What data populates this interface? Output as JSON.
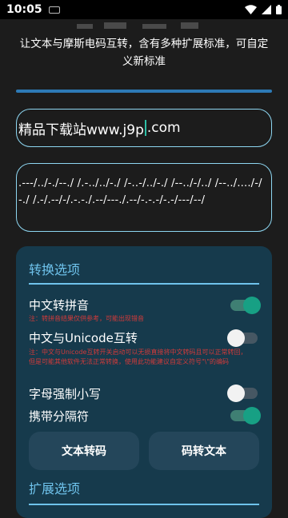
{
  "status_bar": {
    "time": "10:05"
  },
  "header": {
    "subtitle": "让文本与摩斯电码互转，含有多种扩展标准，可自定义新标准"
  },
  "input": {
    "text_before_caret": "精品下载站www.j9p",
    "text_after_caret": ".com"
  },
  "output": {
    "morse": ".---/../-./--./ /.-../../-./ /-..-/../-./ /--../-/../ /--../..../-/-./ /.-/.--/-/.-.-./.--/---./.--/-.-.-/-.-/---/--/"
  },
  "options_card": {
    "section_title": "转换选项",
    "options": [
      {
        "label": "中文转拼音",
        "note": "注：转拼音结果仅供参考，可能出现错音",
        "state": "on"
      },
      {
        "label": "中文与Unicode互转",
        "note": "注：中文与Unicode互转开关启动可以无损直接将中文转码且可以正常转回，但是可能其他软件无法正常转换，使用此功能建议自定义符号\"\\\"的编码",
        "state": "off"
      },
      {
        "label": "字母强制小写",
        "state": "off"
      },
      {
        "label": "携带分隔符",
        "state": "on"
      }
    ],
    "buttons": {
      "encode": "文本转码",
      "decode": "码转文本"
    },
    "extend_title": "扩展选项"
  },
  "colors": {
    "accent": "#6fc3ec",
    "switch_on": "#17a084",
    "warning": "#d23a3a",
    "card": "#163a4c"
  }
}
